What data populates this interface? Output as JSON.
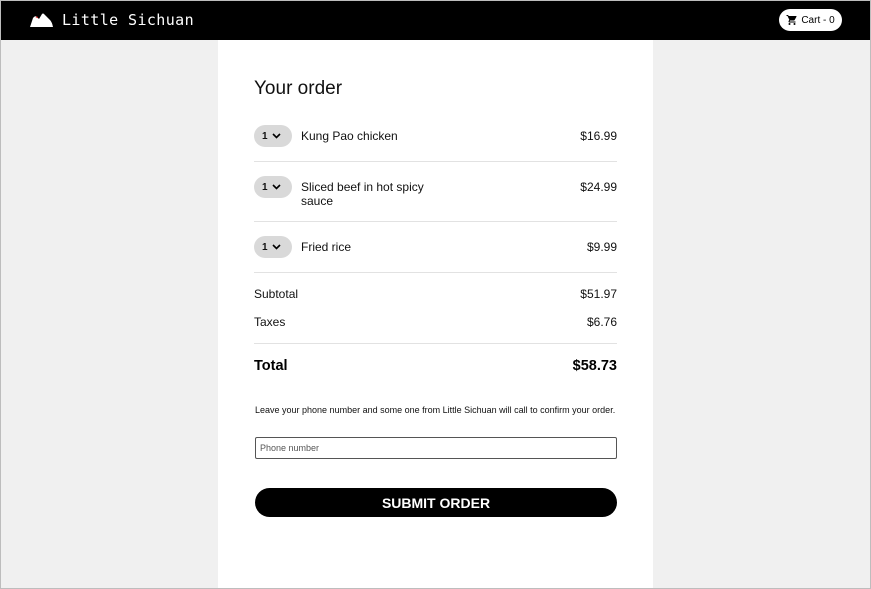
{
  "header": {
    "brand_name": "Little Sichuan",
    "logo_icon": "mountain-logo-icon",
    "cart_icon": "shopping-cart-icon",
    "cart_label": "Cart - 0"
  },
  "order": {
    "title": "Your order",
    "items": [
      {
        "qty": "1",
        "name": "Kung Pao chicken",
        "price": "$16.99"
      },
      {
        "qty": "1",
        "name": "Sliced beef in hot spicy sauce",
        "price": "$24.99"
      },
      {
        "qty": "1",
        "name": "Fried rice",
        "price": "$9.99"
      }
    ],
    "subtotal_label": "Subtotal",
    "subtotal_value": "$51.97",
    "taxes_label": "Taxes",
    "taxes_value": "$6.76",
    "total_label": "Total",
    "total_value": "$58.73"
  },
  "contact": {
    "note": "Leave your phone number and some one from Little Sichuan will call to confirm your order.",
    "phone_placeholder": "Phone number",
    "phone_value": ""
  },
  "submit_label": "SUBMIT ORDER"
}
